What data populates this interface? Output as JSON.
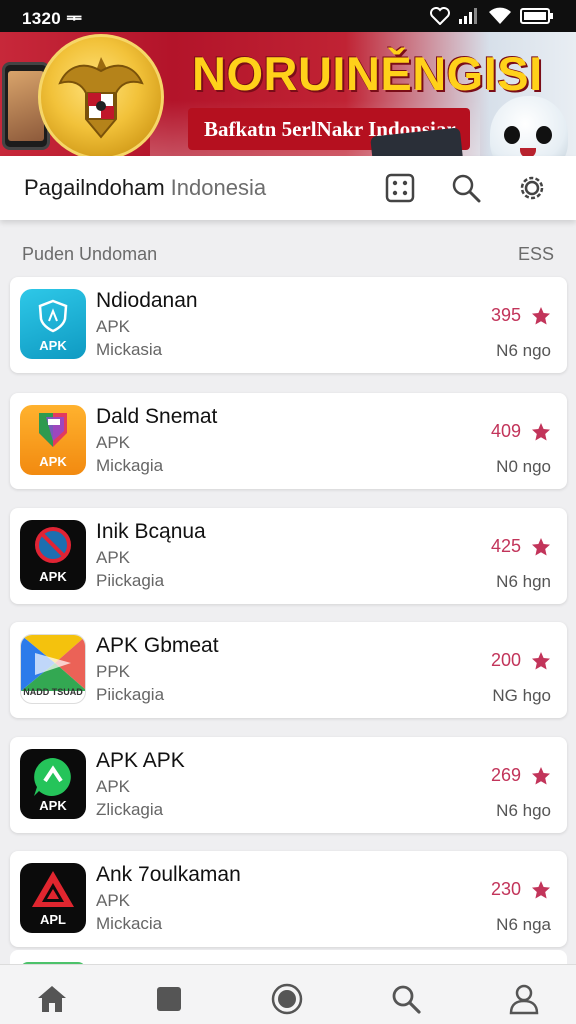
{
  "status_bar": {
    "time": "1320 ᆍ"
  },
  "banner": {
    "title": "NORUINĚNGISI",
    "subtitle": "Bafkatn 5erlNakr Indonsiar"
  },
  "app_bar": {
    "title": "Pagailndoham",
    "subtitle": "Indonesia",
    "actions": [
      "dice-icon",
      "search-icon",
      "settings-icon"
    ]
  },
  "section": {
    "title": "Puden Undoman",
    "action": "ESS"
  },
  "apps": [
    {
      "name": "Ndiodanan",
      "type": "APK",
      "developer": "Mickasia",
      "rating": "395",
      "size": "N6 ngo",
      "icon_tag": "APK",
      "icon_color": "#1fb6d9"
    },
    {
      "name": "Dald Snemat",
      "type": "APK",
      "developer": "Mickagia",
      "rating": "409",
      "size": "N0 ngo",
      "icon_tag": "APK",
      "icon_color": "#f5a623"
    },
    {
      "name": "Inik Bcąnua",
      "type": "APK",
      "developer": "Piickagia",
      "rating": "425",
      "size": "N6 hgn",
      "icon_tag": "APK",
      "icon_color": "#0b0b0b"
    },
    {
      "name": "APK Gbmeat",
      "type": "PPK",
      "developer": "Piickagia",
      "rating": "200",
      "size": "NG hgo",
      "icon_tag": "NADD TSUAD",
      "icon_color": "#ffffff"
    },
    {
      "name": "APK APK",
      "type": "APK",
      "developer": "Zlickagia",
      "rating": "269",
      "size": "N6 hgo",
      "icon_tag": "APK",
      "icon_color": "#0b0b0b"
    },
    {
      "name": "Ank 7oulkaman",
      "type": "APK",
      "developer": "Mickacia",
      "rating": "230",
      "size": "N6 nga",
      "icon_tag": "APL",
      "icon_color": "#0b0b0b"
    }
  ],
  "bottom_nav": [
    "home-icon",
    "square-icon",
    "record-icon",
    "search-icon",
    "profile-icon"
  ],
  "colors": {
    "accent": "#c2345a",
    "banner_red": "#b5101f",
    "banner_gold": "#ffd11a"
  }
}
